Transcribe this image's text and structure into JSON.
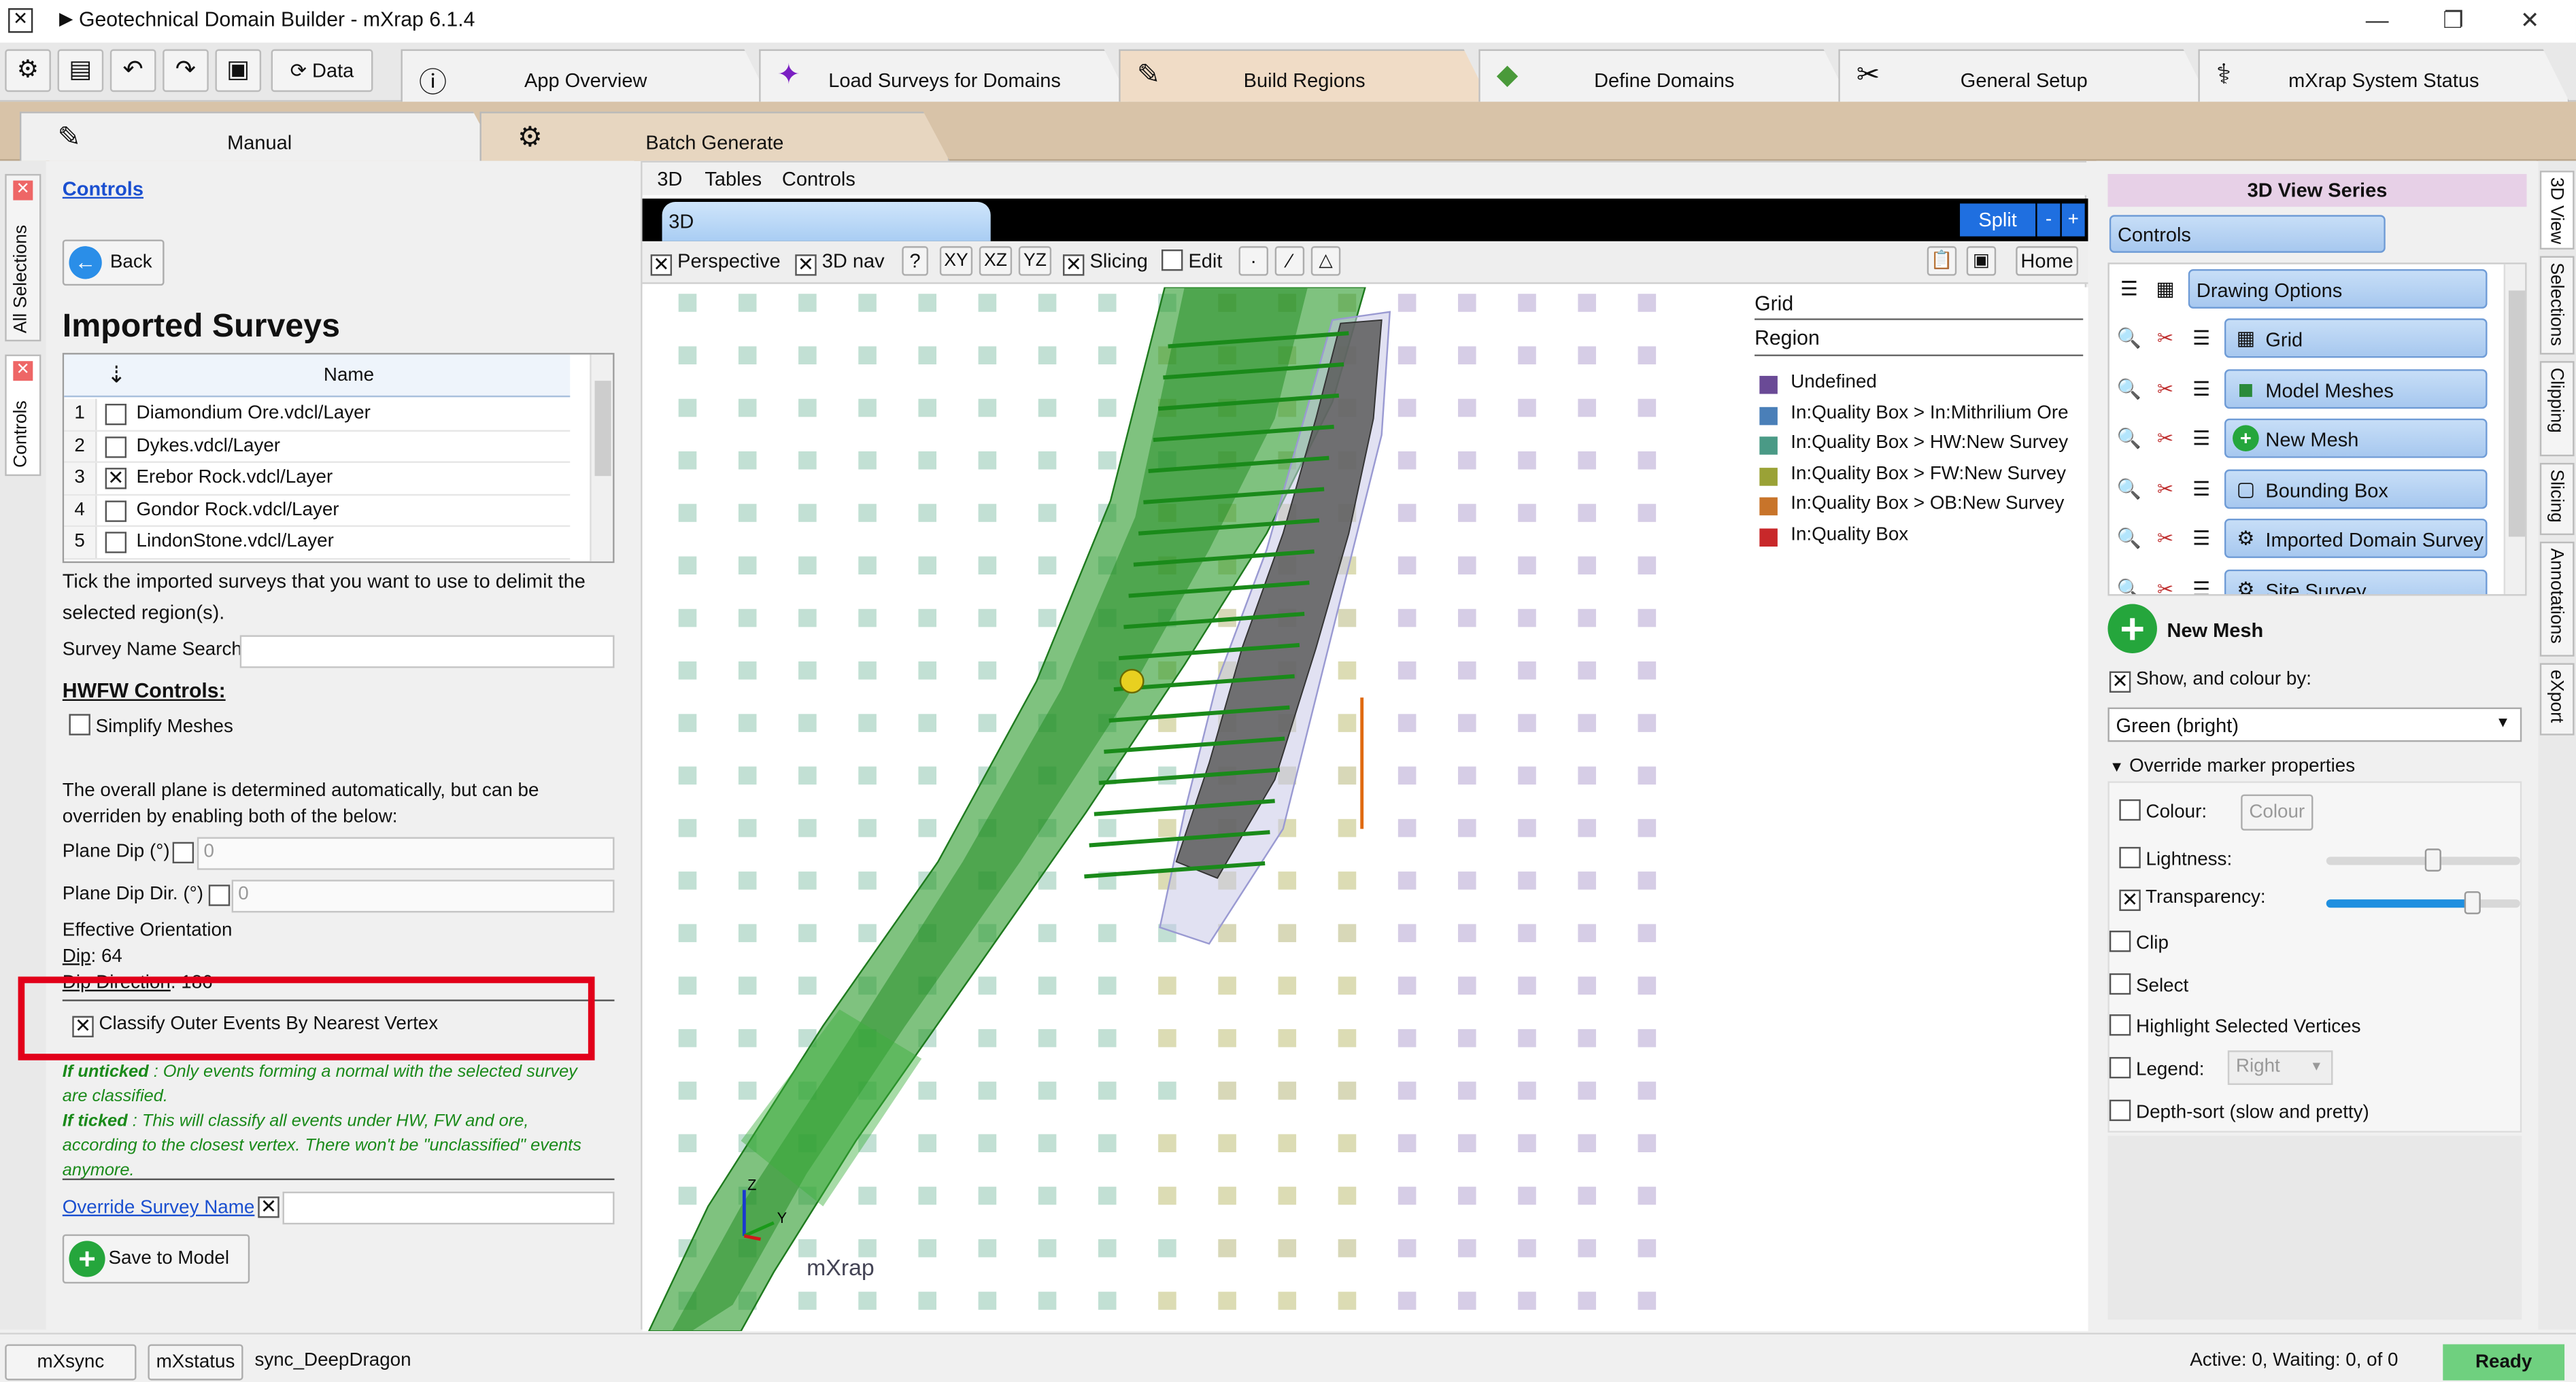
{
  "window": {
    "title": "Geotechnical Domain Builder - mXrap 6.1.4"
  },
  "toolbar": {
    "data_label": "Data"
  },
  "main_tabs": [
    {
      "label": "App Overview",
      "icon": "info-icon"
    },
    {
      "label": "Load Surveys for Domains",
      "icon": "survey-icon"
    },
    {
      "label": "Build Regions",
      "icon": "edit-icon"
    },
    {
      "label": "Define Domains",
      "icon": "domain-icon"
    },
    {
      "label": "General Setup",
      "icon": "tools-icon"
    },
    {
      "label": "mXrap System Status",
      "icon": "status-icon"
    }
  ],
  "sub_tabs": [
    {
      "label": "Manual"
    },
    {
      "label": "Batch Generate"
    }
  ],
  "left_vtabs": [
    "All Selections",
    "Controls"
  ],
  "left": {
    "controls_link": "Controls",
    "back_label": "Back",
    "heading": "Imported Surveys",
    "table_header": "Name",
    "surveys": [
      {
        "n": "1",
        "name": "Diamondium Ore.vdcl/Layer",
        "checked": false
      },
      {
        "n": "2",
        "name": "Dykes.vdcl/Layer",
        "checked": false
      },
      {
        "n": "3",
        "name": "Erebor Rock.vdcl/Layer",
        "checked": true
      },
      {
        "n": "4",
        "name": "Gondor Rock.vdcl/Layer",
        "checked": false
      },
      {
        "n": "5",
        "name": "LindonStone.vdcl/Layer",
        "checked": false
      }
    ],
    "tick_help": "Tick the imported surveys that you want to use to delimit the selected region(s).",
    "survey_search_label": "Survey Name Search",
    "hwfw_heading": "HWFW Controls:",
    "simplify_label": "Simplify Meshes",
    "plane_help": "The overall plane is determined automatically, but can be overriden by enabling both of the below:",
    "plane_dip_label": "Plane Dip (°)",
    "plane_dip_value": "0",
    "plane_dipdir_label": "Plane Dip Dir. (°)",
    "plane_dipdir_value": "0",
    "eff_label": "Effective Orientation",
    "dip_key": "Dip",
    "dip_value": ": 64",
    "dipdir_key": "Dip Direction",
    "dipdir_value": ": 186",
    "classify_label": "Classify Outer Events By Nearest Vertex",
    "untick_key": "If unticked",
    "untick_text": " : Only events forming a normal with the selected survey are classified.",
    "tick_key": "If ticked",
    "tick_text": " : This will classify all events under HW, FW and ore, according to the closest vertex. There won't be \"unclassified\" events anymore.",
    "override_label": "Override Survey Name",
    "save_label": "Save to Model"
  },
  "viewport": {
    "menu": [
      "3D",
      "Tables",
      "Controls"
    ],
    "tab_label": "3D",
    "split_label": "Split",
    "perspective_label": "Perspective",
    "nav_label": "3D nav",
    "help_label": "?",
    "xy_label": "XY",
    "xz_label": "XZ",
    "yz_label": "YZ",
    "slicing_label": "Slicing",
    "edit_label": "Edit",
    "home_label": "Home",
    "watermark": "mXrap",
    "axis_z": "Z",
    "axis_y": "Y",
    "legend": {
      "title": "Grid",
      "subtitle": "Region",
      "entries": [
        {
          "label": "Undefined",
          "color": "#6a4a96"
        },
        {
          "label": "In:Quality Box > In:Mithrilium Ore",
          "color": "#4a7fb8"
        },
        {
          "label": "In:Quality Box > HW:New Survey",
          "color": "#4a9a86"
        },
        {
          "label": "In:Quality Box > FW:New Survey",
          "color": "#9aa236"
        },
        {
          "label": "In:Quality Box > OB:New Survey",
          "color": "#c8742a"
        },
        {
          "label": "In:Quality Box",
          "color": "#c8282a"
        }
      ]
    }
  },
  "right": {
    "title": "3D View Series",
    "controls_label": "Controls",
    "drawing_options": "Drawing Options",
    "layers": [
      {
        "label": "Grid",
        "icon": "grid-icon"
      },
      {
        "label": "Model Meshes",
        "icon": "mesh-icon"
      },
      {
        "label": "New Mesh",
        "icon": "plus-icon"
      },
      {
        "label": "Bounding Box",
        "icon": "box-icon"
      },
      {
        "label": "Imported Domain Survey",
        "icon": "survey-icon"
      },
      {
        "label": "Site Survey",
        "icon": "survey-icon"
      }
    ],
    "selected_title": "New Mesh",
    "show_label": "Show, and colour by:",
    "colour_select": "Green (bright)",
    "override_label": "Override marker properties",
    "colour_label": "Colour:",
    "colour_btn": "Colour",
    "lightness_label": "Lightness:",
    "lightness_level": 0.55,
    "transparency_label": "Transparency:",
    "transparency_level": 0.75,
    "clip_label": "Clip",
    "select_label": "Select",
    "highlight_label": "Highlight Selected Vertices",
    "legend_label": "Legend:",
    "legend_value": "Right",
    "depth_label": "Depth-sort (slow and pretty)"
  },
  "right_vtabs": [
    "3D View",
    "Selections",
    "Clipping",
    "Slicing",
    "Annotations",
    "eXport"
  ],
  "status": {
    "mxsync": "mXsync",
    "mxstatus": "mXstatus",
    "sync_name": "sync_DeepDragon",
    "active": "Active: 0, Waiting: 0, of 0",
    "ready": "Ready"
  },
  "colors": {
    "highlight": "#e2001a",
    "ready": "#6fd07f",
    "active_tab": "#f0dcc6",
    "sub_bar": "#d8c3a8"
  }
}
